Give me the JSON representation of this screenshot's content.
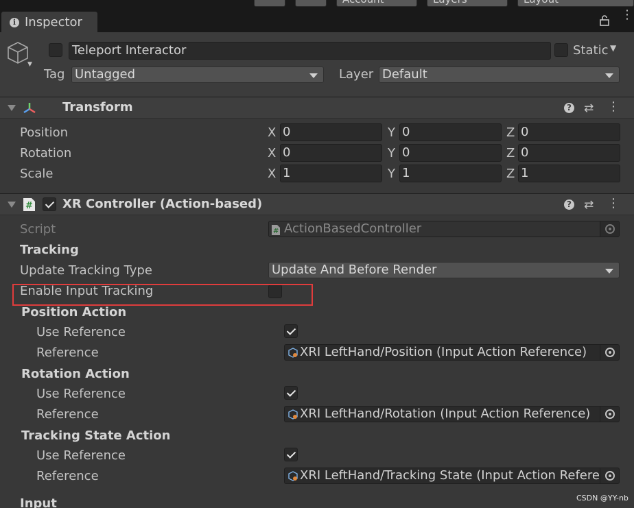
{
  "window": {
    "tab_title": "Inspector",
    "top_buttons": [
      "Account",
      "Layers",
      "Layout"
    ]
  },
  "gameobject": {
    "name": "Teleport Interactor",
    "static_label": "Static",
    "tag_label": "Tag",
    "tag_value": "Untagged",
    "layer_label": "Layer",
    "layer_value": "Default"
  },
  "transform": {
    "title": "Transform",
    "rows": [
      {
        "label": "Position",
        "x": "0",
        "y": "0",
        "z": "0"
      },
      {
        "label": "Rotation",
        "x": "0",
        "y": "0",
        "z": "0"
      },
      {
        "label": "Scale",
        "x": "1",
        "y": "1",
        "z": "1"
      }
    ],
    "axes": {
      "x": "X",
      "y": "Y",
      "z": "Z"
    }
  },
  "xr_controller": {
    "title": "XR Controller (Action-based)",
    "script_label": "Script",
    "script_value": "ActionBasedController",
    "tracking_header": "Tracking",
    "update_tracking_label": "Update Tracking Type",
    "update_tracking_value": "Update And Before Render",
    "enable_input_tracking_label": "Enable Input Tracking",
    "position_action": {
      "header": "Position Action",
      "use_reference_label": "Use Reference",
      "reference_label": "Reference",
      "reference_value": "XRI LeftHand/Position (Input Action Reference)"
    },
    "rotation_action": {
      "header": "Rotation Action",
      "use_reference_label": "Use Reference",
      "reference_label": "Reference",
      "reference_value": "XRI LeftHand/Rotation (Input Action Reference)"
    },
    "tracking_state_action": {
      "header": "Tracking State Action",
      "use_reference_label": "Use Reference",
      "reference_label": "Reference",
      "reference_value": "XRI LeftHand/Tracking State (Input Action Referen"
    },
    "input_header": "Input"
  },
  "watermark": "CSDN @YY-nb",
  "colors": {
    "highlight_box": "#e03c3c",
    "panel_bg": "#383838"
  }
}
